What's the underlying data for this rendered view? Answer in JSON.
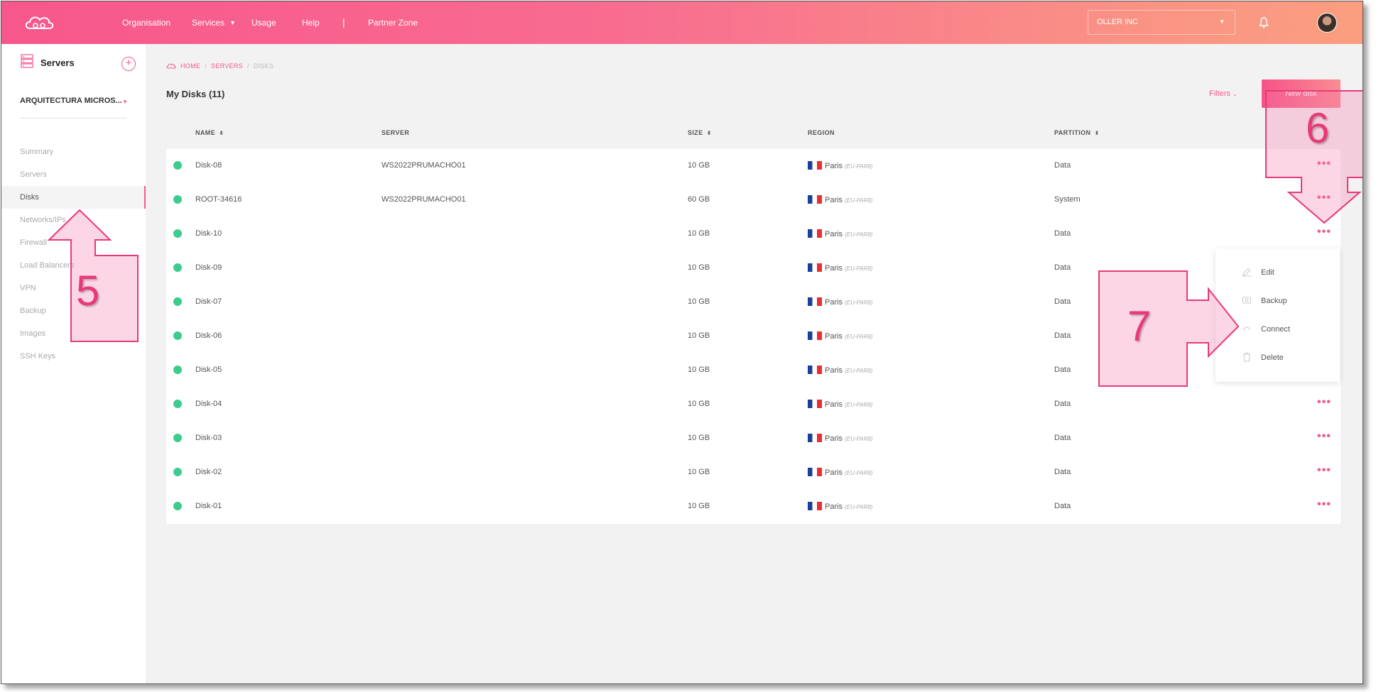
{
  "topbar": {
    "nav": [
      "Organisation",
      "Services",
      "Usage",
      "Help",
      "|",
      "Partner Zone"
    ],
    "org_select": "OLLER INC"
  },
  "sidebar": {
    "title": "Servers",
    "add_label": "+",
    "project": "ARQUITECTURA MICROS...",
    "items": [
      {
        "label": "Summary",
        "active": false
      },
      {
        "label": "Servers",
        "active": false
      },
      {
        "label": "Disks",
        "active": true
      },
      {
        "label": "Networks/IPs",
        "active": false
      },
      {
        "label": "Firewall",
        "active": false
      },
      {
        "label": "Load Balancers",
        "active": false
      },
      {
        "label": "VPN",
        "active": false
      },
      {
        "label": "Backup",
        "active": false
      },
      {
        "label": "Images",
        "active": false
      },
      {
        "label": "SSH Keys",
        "active": false
      }
    ]
  },
  "breadcrumb": [
    "HOME",
    "SERVERS",
    "DISKS"
  ],
  "main": {
    "title": "My Disks (11)",
    "filters": "Filters",
    "new_disk": "New disk"
  },
  "table": {
    "columns": [
      "NAME",
      "SERVER",
      "SIZE",
      "REGION",
      "PARTITION"
    ],
    "rows": [
      {
        "name": "Disk-08",
        "server": "WS2022PRUMACHO01",
        "size": "10 GB",
        "city": "Paris",
        "region": "(EU-PAR8)",
        "partition": "Data"
      },
      {
        "name": "ROOT-34616",
        "server": "WS2022PRUMACHO01",
        "size": "60 GB",
        "city": "Paris",
        "region": "(EU-PAR8)",
        "partition": "System"
      },
      {
        "name": "Disk-10",
        "server": "",
        "size": "10 GB",
        "city": "Paris",
        "region": "(EU-PAR8)",
        "partition": "Data"
      },
      {
        "name": "Disk-09",
        "server": "",
        "size": "10 GB",
        "city": "Paris",
        "region": "(EU-PAR8)",
        "partition": "Data"
      },
      {
        "name": "Disk-07",
        "server": "",
        "size": "10 GB",
        "city": "Paris",
        "region": "(EU-PAR8)",
        "partition": "Data"
      },
      {
        "name": "Disk-06",
        "server": "",
        "size": "10 GB",
        "city": "Paris",
        "region": "(EU-PAR8)",
        "partition": "Data"
      },
      {
        "name": "Disk-05",
        "server": "",
        "size": "10 GB",
        "city": "Paris",
        "region": "(EU-PAR8)",
        "partition": "Data"
      },
      {
        "name": "Disk-04",
        "server": "",
        "size": "10 GB",
        "city": "Paris",
        "region": "(EU-PAR8)",
        "partition": "Data"
      },
      {
        "name": "Disk-03",
        "server": "",
        "size": "10 GB",
        "city": "Paris",
        "region": "(EU-PAR8)",
        "partition": "Data"
      },
      {
        "name": "Disk-02",
        "server": "",
        "size": "10 GB",
        "city": "Paris",
        "region": "(EU-PAR8)",
        "partition": "Data"
      },
      {
        "name": "Disk-01",
        "server": "",
        "size": "10 GB",
        "city": "Paris",
        "region": "(EU-PAR8)",
        "partition": "Data"
      }
    ],
    "more_label": "•••"
  },
  "context_menu": {
    "items": [
      {
        "label": "Edit",
        "icon": "edit-icon"
      },
      {
        "label": "Backup",
        "icon": "backup-icon"
      },
      {
        "label": "Connect",
        "icon": "connect-icon"
      },
      {
        "label": "Delete",
        "icon": "delete-icon"
      }
    ]
  },
  "callouts": [
    "5",
    "6",
    "7"
  ],
  "colors": {
    "accent": "#f45b8a",
    "status_ok": "#3dcc8e",
    "callout": "#e8397a"
  }
}
